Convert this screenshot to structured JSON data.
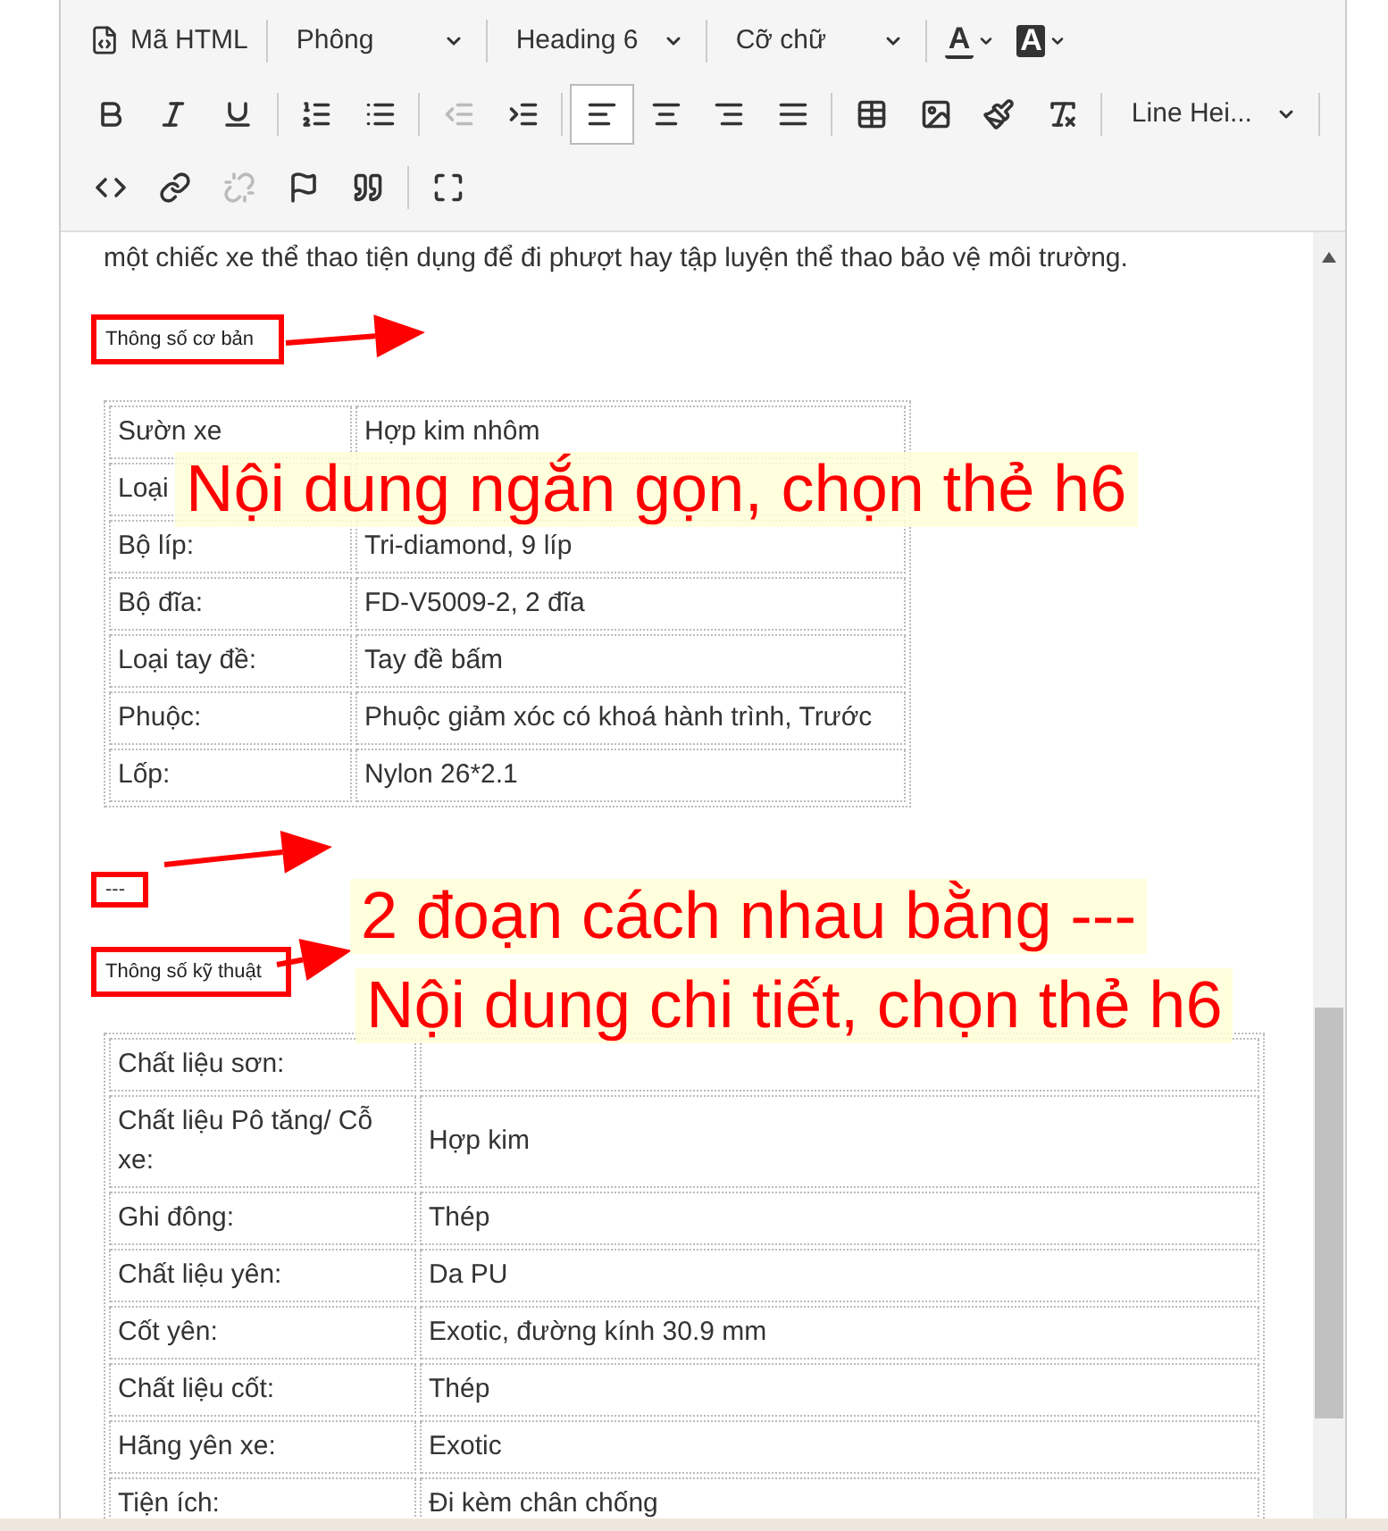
{
  "toolbar": {
    "rows": [
      [
        {
          "kind": "html",
          "label": "Mã HTML"
        },
        {
          "kind": "dropdown",
          "label": "Phông"
        },
        {
          "kind": "dropdown",
          "label": "Heading 6"
        },
        {
          "kind": "dropdown",
          "label": "Cỡ chữ"
        },
        {
          "kind": "forecolor",
          "label": "A"
        },
        {
          "kind": "backcolor",
          "label": "A"
        }
      ],
      [
        {
          "kind": "bold",
          "disabled": false,
          "selected": false
        },
        {
          "kind": "italic",
          "disabled": false,
          "selected": false
        },
        {
          "kind": "underline",
          "disabled": false,
          "selected": false
        },
        {
          "kind": "ol",
          "disabled": false,
          "selected": false
        },
        {
          "kind": "ul",
          "disabled": false,
          "selected": false
        },
        {
          "kind": "outdent",
          "disabled": true,
          "selected": false
        },
        {
          "kind": "indent",
          "disabled": false,
          "selected": false
        },
        {
          "kind": "alignleft",
          "disabled": false,
          "selected": true
        },
        {
          "kind": "aligncenter",
          "disabled": false,
          "selected": false
        },
        {
          "kind": "alignright",
          "disabled": false,
          "selected": false
        },
        {
          "kind": "justify",
          "disabled": false,
          "selected": false
        },
        {
          "kind": "table",
          "disabled": false,
          "selected": false
        },
        {
          "kind": "image",
          "disabled": false,
          "selected": false
        },
        {
          "kind": "brush",
          "disabled": false,
          "selected": false
        },
        {
          "kind": "clearformat",
          "disabled": false,
          "selected": false
        },
        {
          "kind": "dropdown",
          "label": "Line Hei..."
        }
      ],
      [
        {
          "kind": "codeview",
          "disabled": false,
          "selected": false
        },
        {
          "kind": "link",
          "disabled": false,
          "selected": false
        },
        {
          "kind": "unlink",
          "disabled": true,
          "selected": false
        },
        {
          "kind": "flag",
          "disabled": false,
          "selected": false
        },
        {
          "kind": "quote",
          "disabled": false,
          "selected": false
        },
        {
          "kind": "fullscreen",
          "disabled": false,
          "selected": false
        }
      ]
    ]
  },
  "content": {
    "intro": "một chiếc xe thể thao tiện dụng để đi phượt hay tập luyện thể thao bảo vệ môi trường.",
    "heading_1": "Thông số cơ bản",
    "table_1": [
      {
        "label": "Sườn xe",
        "value": "Hợp kim nhôm"
      },
      {
        "label": "Loại"
      },
      {
        "label": "Bộ líp:",
        "value": "Tri-diamond, 9 líp"
      },
      {
        "label": "Bộ đĩa:",
        "value": "FD-V5009-2, 2 đĩa"
      },
      {
        "label": "Loại tay đề:",
        "value": "Tay đề bấm"
      },
      {
        "label": "Phuộc:",
        "value": "Phuộc giảm xóc có khoá hành trình, Trước"
      },
      {
        "label": "Lốp:",
        "value": "Nylon 26*2.1"
      }
    ],
    "separator": "---",
    "heading_2": "Thông số kỹ thuật",
    "table_2": [
      {
        "label": "Chất liệu sơn:"
      },
      {
        "label": "Chất liệu Pô tăng/ Cỗ xe:",
        "value": "Hợp kim"
      },
      {
        "label": "Ghi đông:",
        "value": "Thép"
      },
      {
        "label": "Chất liệu yên:",
        "value": "Da PU"
      },
      {
        "label": "Cốt yên:",
        "value": "Exotic, đường kính 30.9 mm"
      },
      {
        "label": "Chất liệu cốt:",
        "value": "Thép"
      },
      {
        "label": "Hãng yên xe:",
        "value": "Exotic"
      },
      {
        "label": "Tiện ích:",
        "value": "Đi kèm chân chống"
      }
    ]
  },
  "annotations": [
    "Nội dung ngắn gọn, chọn thẻ h6",
    "2 đoạn cách nhau bằng ---",
    "Nội dung chi tiết, chọn thẻ h6"
  ]
}
